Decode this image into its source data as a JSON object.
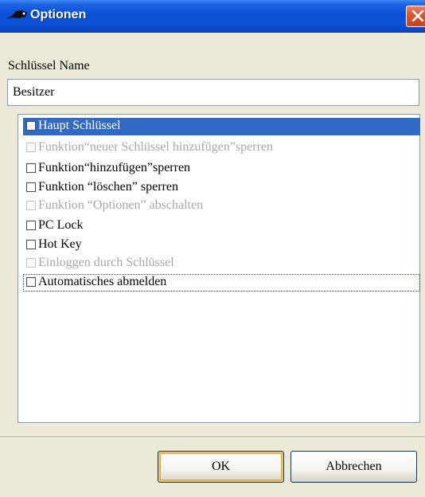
{
  "window": {
    "title": "Optionen"
  },
  "form": {
    "name_label": "Schlüssel Name",
    "name_value": "Besitzer"
  },
  "options": [
    {
      "label": "Haupt Schlüssel",
      "checked": false,
      "enabled": true,
      "selected": true
    },
    {
      "label": "Funktion“neuer Schlüssel hinzufügen”sperren",
      "checked": false,
      "enabled": false
    },
    {
      "label": "Funktion“hinzufügen”sperren",
      "checked": false,
      "enabled": true
    },
    {
      "label": "Funktion “löschen” sperren",
      "checked": false,
      "enabled": true
    },
    {
      "label": "Funktion “Optionen” abschalten",
      "checked": false,
      "enabled": false
    },
    {
      "label": "PC Lock",
      "checked": false,
      "enabled": true
    },
    {
      "label": "Hot Key",
      "checked": false,
      "enabled": true
    },
    {
      "label": "Einloggen durch Schlüssel",
      "checked": false,
      "enabled": false
    },
    {
      "label": "Automatisches abmelden",
      "checked": false,
      "enabled": true,
      "focused": true
    }
  ],
  "buttons": {
    "ok": "OK",
    "cancel": "Abbrechen"
  }
}
